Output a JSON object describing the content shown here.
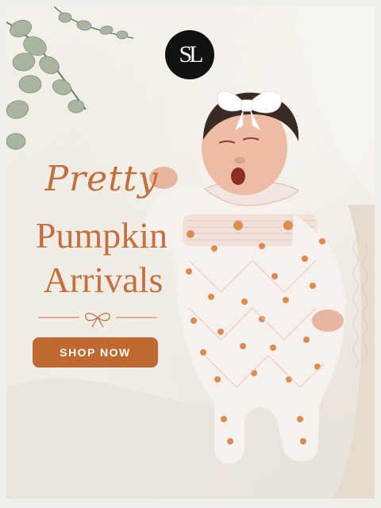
{
  "brand": {
    "logo_text": "SL",
    "logo_alt": "brand monogram"
  },
  "headline": {
    "script": "Pretty",
    "line1": "Pumpkin",
    "line2": "Arrivals"
  },
  "cta": {
    "label": "SHOP NOW"
  },
  "colors": {
    "accent": "#c46f3c",
    "button": "#bf6830",
    "logo_bg": "#111111",
    "background": "#f1efea"
  },
  "icons": {
    "divider": "bow-icon",
    "foliage": "eucalyptus-branch"
  }
}
